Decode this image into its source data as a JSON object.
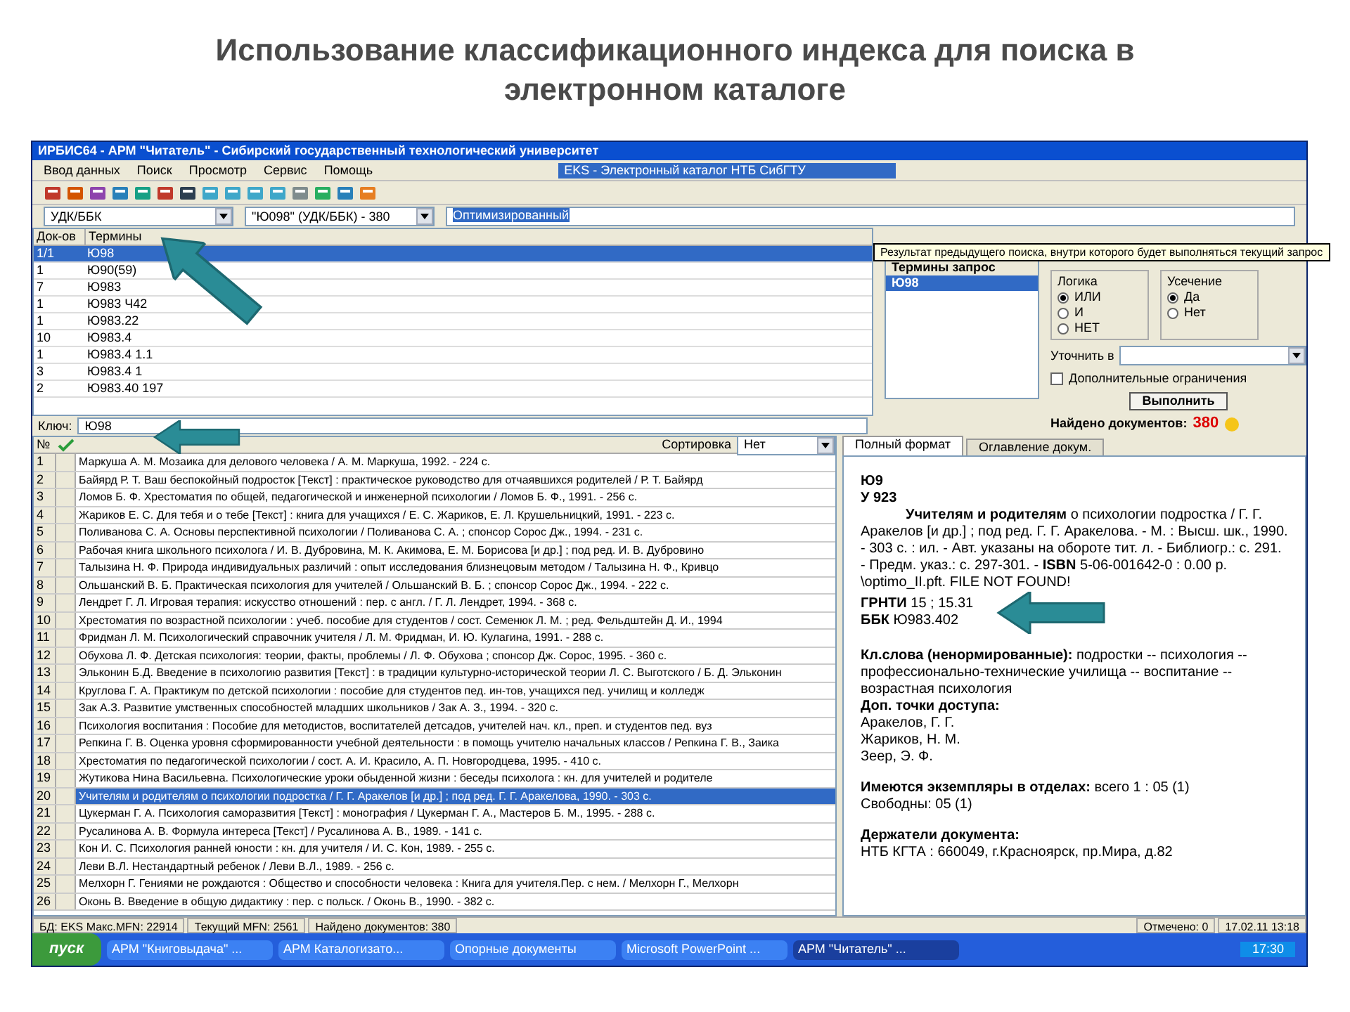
{
  "slide_title": "Использование классификационного индекса для поиска в электронном каталоге",
  "window": {
    "title": "ИРБИС64 - АРМ \"Читатель\" - Сибирский государственный технологический университет"
  },
  "menu": [
    "Ввод данных",
    "Поиск",
    "Просмотр",
    "Сервис",
    "Помощь"
  ],
  "database": "EKS - Электронный каталог НТБ СибГТУ",
  "search_bar": {
    "prefix": "УДК/ББК",
    "query": "\"Ю098\" (УДК/ББК) - 380",
    "mode": "Оптимизированный"
  },
  "terms": {
    "columns": [
      "Док-ов",
      "Термины"
    ],
    "rows": [
      {
        "count": "1/1",
        "term": "Ю98",
        "selected": true
      },
      {
        "count": "1",
        "term": "Ю90(59)",
        "selected": false
      },
      {
        "count": "7",
        "term": "Ю983",
        "selected": false
      },
      {
        "count": "1",
        "term": "Ю983 Ч42",
        "selected": false
      },
      {
        "count": "1",
        "term": "Ю983.22",
        "selected": false
      },
      {
        "count": "10",
        "term": "Ю983.4",
        "selected": false
      },
      {
        "count": "1",
        "term": "Ю983.4 1.1",
        "selected": false
      },
      {
        "count": "3",
        "term": "Ю983.4 1",
        "selected": false
      },
      {
        "count": "2",
        "term": "Ю983.40 197",
        "selected": false
      }
    ]
  },
  "key_field": {
    "label": "Ключ:",
    "value": "Ю98"
  },
  "query_panel": {
    "tooltip": "Результат предыдущего поиска, внутри которого будет выполняться текущий запрос",
    "terms_title": "Термины запрос",
    "terms": [
      {
        "term": "Ю98",
        "selected": true
      }
    ],
    "logic": {
      "title": "Логика",
      "options": [
        {
          "label": "ИЛИ",
          "selected": true
        },
        {
          "label": "И",
          "selected": false
        },
        {
          "label": "НЕТ",
          "selected": false
        }
      ]
    },
    "truncation": {
      "title": "Усечение",
      "options": [
        {
          "label": "Да",
          "selected": true
        },
        {
          "label": "Нет",
          "selected": false
        }
      ]
    },
    "restrict_label": "Уточнить в",
    "extra": {
      "label": "Дополнительные ограничения",
      "checked": false
    },
    "run_button": "Выполнить",
    "found_label": "Найдено документов:",
    "found_count": "380"
  },
  "results": {
    "number_column": "№",
    "sort_label": "Сортировка",
    "sort_value": "Нет",
    "rows": [
      {
        "number": "1",
        "text": "Маркуша А. М. Мозаика для делового человека / А. М. Маркуша, 1992. - 224 с.",
        "selected": false
      },
      {
        "number": "2",
        "text": "Байярд Р. Т. Ваш беспокойный подросток [Текст] : практическое руководство для отчаявшихся родителей / Р. Т. Байярд",
        "selected": false
      },
      {
        "number": "3",
        "text": "Ломов Б. Ф. Хрестоматия по общей, педагогической и инженерной психологии / Ломов Б. Ф., 1991. - 256 с.",
        "selected": false
      },
      {
        "number": "4",
        "text": "Жариков Е. С. Для тебя и о тебе [Текст] : книга для учащихся / Е. С. Жариков, Е. Л. Крушельницкий, 1991. - 223 с.",
        "selected": false
      },
      {
        "number": "5",
        "text": "Поливанова С. А. Основы перспективной психологии / Поливанова С. А. ; спонсор Сорос Дж., 1994. - 231 с.",
        "selected": false
      },
      {
        "number": "6",
        "text": "Рабочая книга школьного психолога / И. В. Дубровина, М. К. Акимова, Е. М. Борисова [и др.] ; под ред. И. В. Дубровино",
        "selected": false
      },
      {
        "number": "7",
        "text": "Талызина Н. Ф. Природа индивидуальных различий : опыт исследования близнецовым методом / Талызина Н. Ф., Кривцо",
        "selected": false
      },
      {
        "number": "8",
        "text": "Ольшанский В. Б. Практическая психология для учителей / Ольшанский В. Б. ; спонсор Сорос Дж., 1994. - 222 с.",
        "selected": false
      },
      {
        "number": "9",
        "text": "Лендрет Г. Л. Игровая терапия: искусство отношений : пер. с англ. / Г. Л. Лендрет, 1994. - 368 с.",
        "selected": false
      },
      {
        "number": "10",
        "text": "Хрестоматия по возрастной психологии : учеб. пособие для студентов / сост. Семенюк Л. М. ; ред. Фельдштейн Д. И., 1994",
        "selected": false
      },
      {
        "number": "11",
        "text": "Фридман Л. М. Психологический справочник учителя / Л. М. Фридман, И. Ю. Кулагина, 1991. - 288 с.",
        "selected": false
      },
      {
        "number": "12",
        "text": "Обухова Л. Ф. Детская психология: теории, факты, проблемы / Л. Ф. Обухова ; спонсор Дж. Сорос, 1995. - 360 с.",
        "selected": false
      },
      {
        "number": "13",
        "text": "Эльконин Б.Д. Введение в психологию развития [Текст] : в традиции культурно-исторической теории Л. С. Выготского / Б. Д. Эльконин",
        "selected": false
      },
      {
        "number": "14",
        "text": "Круглова Г. А. Практикум по детской психологии : пособие для студентов пед. ин-тов, учащихся пед. училищ и колледж",
        "selected": false
      },
      {
        "number": "15",
        "text": "Зак А.З. Развитие умственных способностей младших школьников / Зак А. З., 1994. - 320 с.",
        "selected": false
      },
      {
        "number": "16",
        "text": "Психология воспитания : Пособие для методистов, воспитателей детсадов, учителей нач. кл., преп. и студентов пед. вуз",
        "selected": false
      },
      {
        "number": "17",
        "text": "Репкина Г. В. Оценка уровня сформированности учебной деятельности : в помощь учителю начальных классов / Репкина Г. В., Заика",
        "selected": false
      },
      {
        "number": "18",
        "text": "Хрестоматия по педагогической психологии / сост. А. И. Красило, А. П. Новгородцева, 1995. - 410 с.",
        "selected": false
      },
      {
        "number": "19",
        "text": "Жутикова Нина Васильевна. Психологические уроки обыденной жизни : беседы психолога : кн. для учителей и родителе",
        "selected": false
      },
      {
        "number": "20",
        "text": "Учителям и родителям о психологии подростка / Г. Г. Аракелов [и др.] ; под ред. Г. Г. Аракелова, 1990. - 303 с.",
        "selected": true
      },
      {
        "number": "21",
        "text": "Цукерман Г. А. Психология саморазвития [Текст] : монография / Цукерман Г. А., Мастеров Б. М., 1995. - 288 с.",
        "selected": false
      },
      {
        "number": "22",
        "text": "Русалинова А. В. Формула интереса [Текст] / Русалинова А. В., 1989. - 141 с.",
        "selected": false
      },
      {
        "number": "23",
        "text": "Кон И. С. Психология ранней юности : кн. для учителя / И. С. Кон, 1989. - 255 с.",
        "selected": false
      },
      {
        "number": "24",
        "text": "Леви В.Л. Нестандартный ребенок / Леви В.Л., 1989. - 256 с.",
        "selected": false
      },
      {
        "number": "25",
        "text": "Мелхорн Г. Гениями не рождаются : Общество и способности человека : Книга для учителя.Пер. с нем. / Мелхорн Г., Мелхорн",
        "selected": false
      },
      {
        "number": "26",
        "text": "Оконь В. Введение в общую дидактику : пер. с польск. / Оконь В., 1990. - 382 с.",
        "selected": false
      }
    ]
  },
  "document": {
    "tabs": [
      {
        "label": "Полный формат",
        "selected": true
      },
      {
        "label": "Оглавление докум.",
        "selected": false
      }
    ],
    "blocks": [
      [
        {
          "kind": "heading",
          "text": "Ю9"
        },
        {
          "kind": "heading",
          "text": "У 923"
        },
        {
          "kind": "indent",
          "text": "**Учителям и родителям** о психологии подростка / Г. Г. Аракелов [и др.] ; под ред. Г. Г. Аракелова. - М. : Высш. шк., 1990. - 303 с. : ил. - Авт. указаны на обороте тит. л. - Библиогр.: с. 291. - Предм. указ.: с. 297-301. - **ISBN** 5-06-001642-0 : 0.00 р. \\optimo_II.pft. FILE NOT FOUND!"
        },
        {
          "kind": "text",
          "text": "**ГРНТИ** 15 ; 15.31"
        },
        {
          "kind": "text",
          "text": "**ББК** Ю983.402"
        }
      ],
      [
        {
          "kind": "text",
          "text": "**Кл.слова (ненормированные):** подростки -- психология -- профессионально-технические училища -- воспитание -- возрастная психология"
        },
        {
          "kind": "heading",
          "text": "Доп. точки доступа:"
        },
        {
          "kind": "text",
          "text": "Аракелов, Г. Г."
        },
        {
          "kind": "text",
          "text": "Жариков, Н. М."
        },
        {
          "kind": "text",
          "text": "Зеер, Э. Ф."
        }
      ],
      [
        {
          "kind": "text",
          "text": "**Имеются экземпляры в отделах:** всего 1 : 05 (1)"
        },
        {
          "kind": "text",
          "text": "Свободны: 05 (1)"
        }
      ],
      [
        {
          "kind": "heading",
          "text": "Держатели документа:"
        },
        {
          "kind": "text",
          "text": "НТБ КГТА : 660049, г.Красноярск, пр.Мира, д.82"
        }
      ]
    ]
  },
  "status_bar": [
    "БД: EKS Макс.MFN: 22914",
    "Текущий MFN: 2561",
    "Найдено документов: 380",
    "Отмечено: 0",
    "17.02.11 13:18"
  ],
  "taskbar": {
    "start": "пуск",
    "items": [
      {
        "label": "АРМ \"Книговыдача\" ...",
        "selected": false
      },
      {
        "label": "АРМ Каталогизато...",
        "selected": false
      },
      {
        "label": "Опорные документы",
        "selected": false
      },
      {
        "label": "Microsoft PowerPoint ...",
        "selected": false
      },
      {
        "label": "АРМ \"Читатель\" ...",
        "selected": true
      }
    ],
    "clock": "17:30"
  }
}
